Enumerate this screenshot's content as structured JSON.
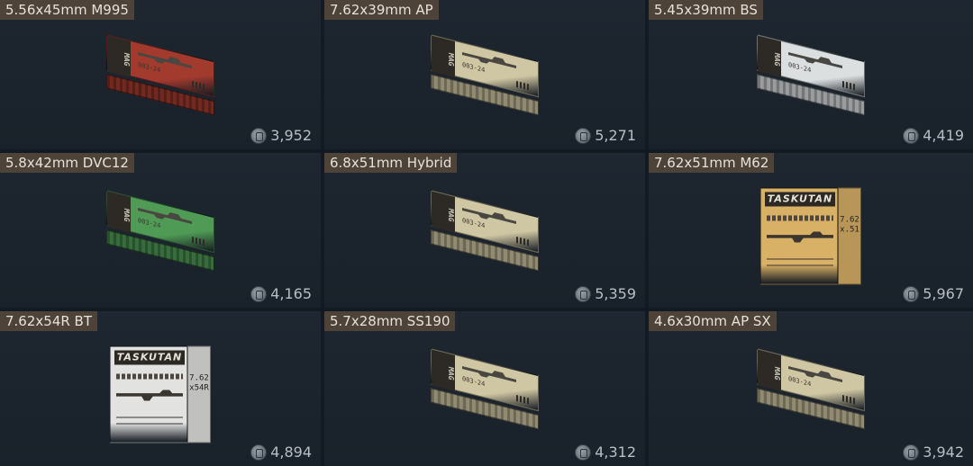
{
  "items": [
    {
      "name": "5.56x45mm M995",
      "price": "3,952",
      "box": {
        "style": "flat",
        "color": "#a33a2e",
        "label": "MAG",
        "code": "003-24"
      }
    },
    {
      "name": "7.62x39mm AP",
      "price": "5,271",
      "box": {
        "style": "flat",
        "color": "#cfc6a3",
        "label": "MAG",
        "code": "003-24"
      }
    },
    {
      "name": "5.45x39mm BS",
      "price": "4,419",
      "box": {
        "style": "flat",
        "color": "#dcdfe0",
        "label": "MAG",
        "code": "003-24"
      }
    },
    {
      "name": "5.8x42mm DVC12",
      "price": "4,165",
      "box": {
        "style": "flat",
        "color": "#4f9a55",
        "label": "MAG",
        "code": "003-24"
      }
    },
    {
      "name": "6.8x51mm Hybrid",
      "price": "5,359",
      "box": {
        "style": "flat",
        "color": "#cfc6a3",
        "label": "MAG",
        "code": "003-24"
      }
    },
    {
      "name": "7.62x51mm M62",
      "price": "5,967",
      "box": {
        "style": "tall",
        "color": "#d8b066",
        "label": "TASKUTAN",
        "side": "7.62 x.51"
      }
    },
    {
      "name": "7.62x54R BT",
      "price": "4,894",
      "box": {
        "style": "tall",
        "color": "#e2e2e0",
        "label": "TASKUTAN",
        "side": "7.62 x54R"
      }
    },
    {
      "name": "5.7x28mm SS190",
      "price": "4,312",
      "box": {
        "style": "flat",
        "color": "#cfc6a3",
        "label": "MAG",
        "code": "003-24"
      }
    },
    {
      "name": "4.6x30mm AP SX",
      "price": "3,942",
      "box": {
        "style": "flat",
        "color": "#cfc6a3",
        "label": "MAG",
        "code": "003-24"
      }
    }
  ],
  "icons": {
    "currency": "coin-icon"
  }
}
